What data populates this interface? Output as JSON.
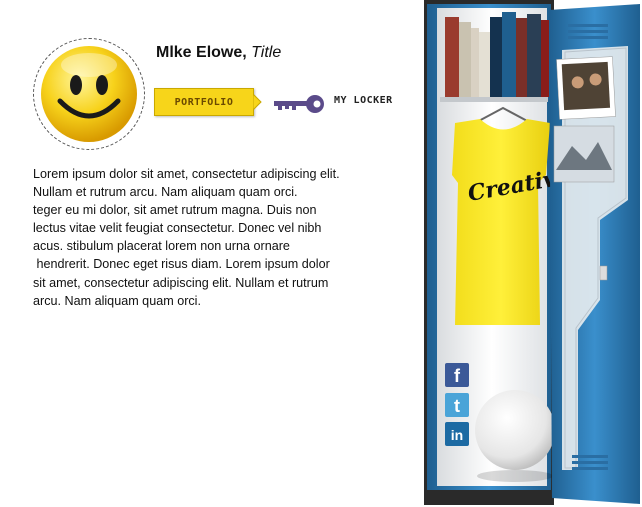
{
  "profile": {
    "name": "Mlke Elowe,",
    "title": "Title",
    "avatar_icon": "smiley-face-icon"
  },
  "nav": {
    "portfolio_label": "PORTFOLIO",
    "locker_label": "MY LOCKER",
    "key_icon": "key-icon"
  },
  "bio": {
    "lines": [
      "Lorem ipsum dolor sit amet, consectetur adipiscing elit.",
      "Nullam et rutrum arcu. Nam aliquam quam orci.",
      "teger eu mi dolor, sit amet rutrum magna. Duis non",
      "lectus vitae velit feugiat consectetur. Donec vel nibh",
      "acus. stibulum placerat lorem non urna ornare",
      " hendrerit. Donec eget risus diam. Lorem ipsum dolor",
      "sit amet, consectetur adipiscing elit. Nullam et rutrum",
      "arcu. Nam aliquam quam orci."
    ]
  },
  "locker": {
    "shirt_text": "Creative",
    "social": [
      {
        "name": "facebook-icon",
        "glyph": "f"
      },
      {
        "name": "twitter-icon",
        "glyph": "t"
      },
      {
        "name": "linkedin-icon",
        "glyph": "in"
      }
    ]
  },
  "colors": {
    "accent_yellow": "#f7d51a",
    "locker_blue": "#2f7fb8",
    "key_purple": "#5b4b8a"
  }
}
